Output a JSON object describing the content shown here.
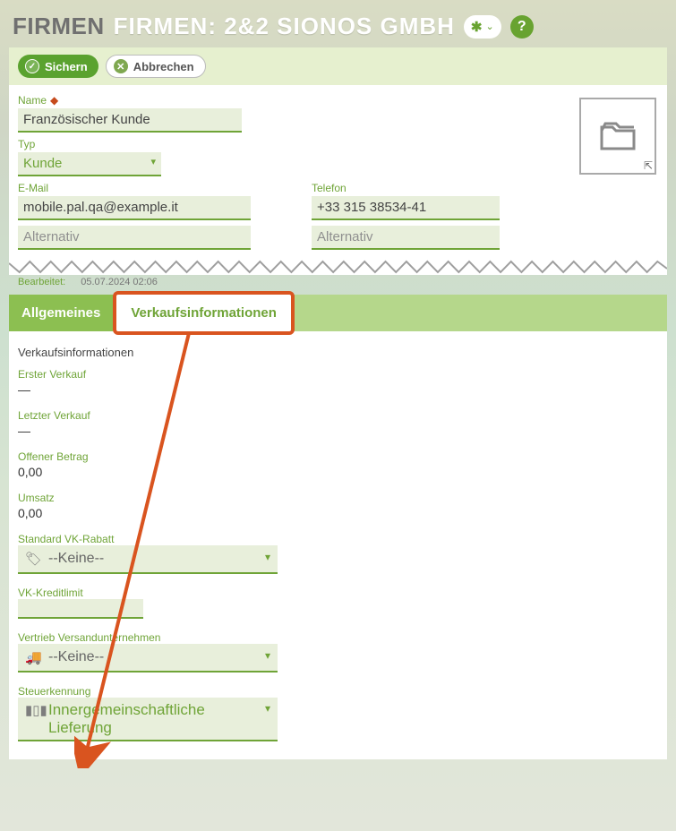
{
  "header": {
    "breadcrumb": "FIRMEN",
    "title": "FIRMEN: 2&2 SIONOS GMBH"
  },
  "actions": {
    "save": "Sichern",
    "cancel": "Abbrechen"
  },
  "form": {
    "name_label": "Name",
    "name_value": "Französischer Kunde",
    "type_label": "Typ",
    "type_value": "Kunde",
    "email_label": "E-Mail",
    "email_value": "mobile.pal.qa@example.it",
    "phone_label": "Telefon",
    "phone_value": "+33 315 38534-41",
    "alt_placeholder": "Alternativ"
  },
  "meta": {
    "edited_label": "Bearbeitet:",
    "edited_value": "05.07.2024 02:06"
  },
  "tabs": {
    "general": "Allgemeines",
    "sales": "Verkaufsinformationen"
  },
  "sales": {
    "section_title": "Verkaufsinformationen",
    "first_sale_label": "Erster Verkauf",
    "first_sale_value": "—",
    "last_sale_label": "Letzter Verkauf",
    "last_sale_value": "—",
    "open_amount_label": "Offener Betrag",
    "open_amount_value": "0,00",
    "revenue_label": "Umsatz",
    "revenue_value": "0,00",
    "std_discount_label": "Standard VK-Rabatt",
    "std_discount_value": "--Keine--",
    "credit_limit_label": "VK-Kreditlimit",
    "shipper_label": "Vertrieb Versandunternehmen",
    "shipper_value": "--Keine--",
    "tax_label": "Steuerkennung",
    "tax_value": "Innergemeinschaftliche Lieferung"
  }
}
